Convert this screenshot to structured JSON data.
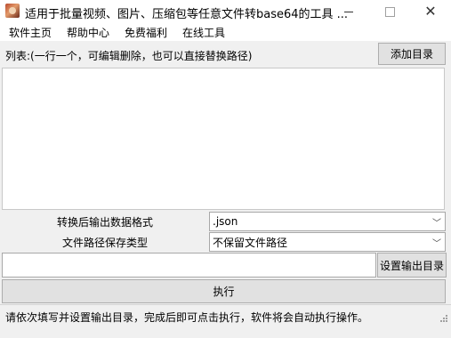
{
  "window": {
    "title": "适用于批量视频、图片、压缩包等任意文件转base64的工具 ...",
    "minimize": "—",
    "maximize": "☐",
    "close": "✕"
  },
  "menu": {
    "items": [
      "软件主页",
      "帮助中心",
      "免费福利",
      "在线工具"
    ]
  },
  "list": {
    "label": "列表:(一行一个，可编辑删除，也可以直接替换路径)",
    "add_button": "添加目录",
    "content": ""
  },
  "form": {
    "format_label": "转换后输出数据格式",
    "format_value": ".json",
    "path_label": "文件路径保存类型",
    "path_value": "不保留文件路径",
    "output_value": "",
    "set_output_button": "设置输出目录",
    "execute_button": "执行"
  },
  "status": {
    "text": "请依次填写并设置输出目录，完成后即可点击执行，软件将会自动执行操作。"
  }
}
